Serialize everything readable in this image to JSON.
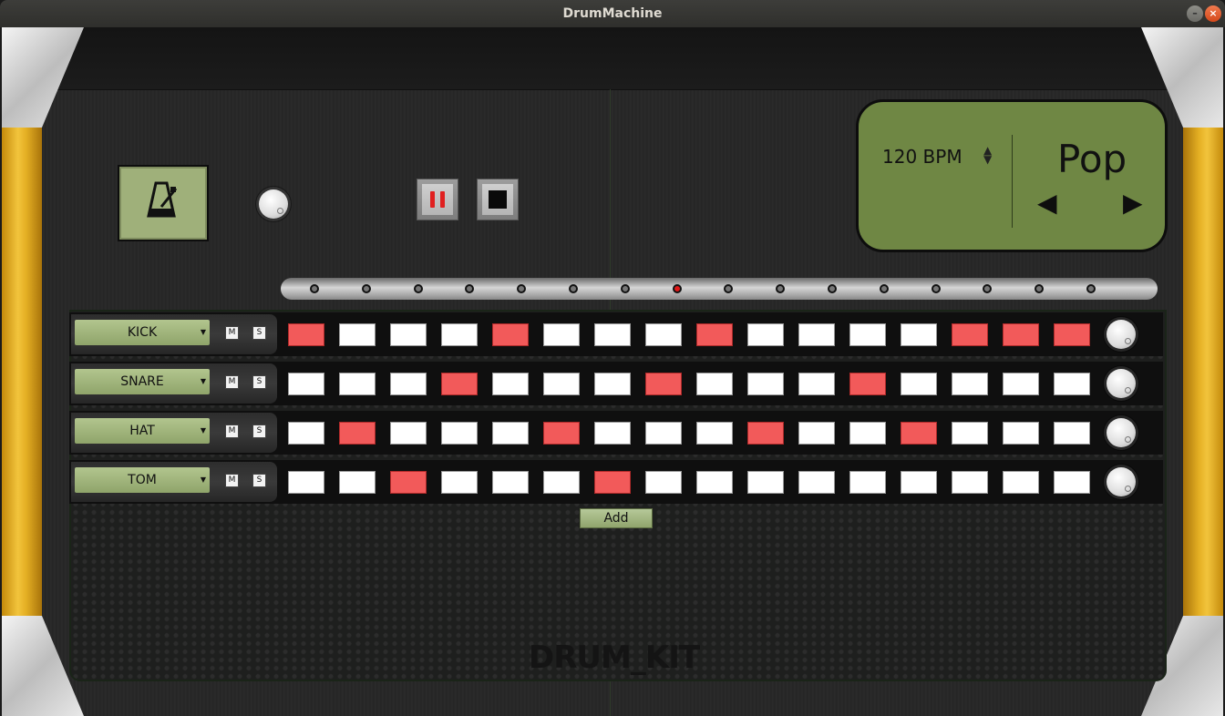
{
  "window": {
    "title": "DrumMachine",
    "minimize_icon": "minimize-icon",
    "close_icon": "close-icon"
  },
  "transport": {
    "metronome_icon": "metronome-icon",
    "metronome_volume_icon": "volume-knob",
    "pause_icon": "pause-icon",
    "stop_icon": "stop-icon"
  },
  "display": {
    "bpm_label": "120 BPM",
    "bpm_spinner": "▲▼",
    "kit_name": "Pop",
    "prev_icon": "◀",
    "next_icon": "▶"
  },
  "step_indicator": {
    "count": 16,
    "active": 8
  },
  "tracks": [
    {
      "instrument": "KICK",
      "mute": "M",
      "solo": "S",
      "steps": [
        1,
        0,
        0,
        0,
        1,
        0,
        0,
        0,
        1,
        0,
        0,
        0,
        0,
        1,
        1,
        1
      ]
    },
    {
      "instrument": "SNARE",
      "mute": "M",
      "solo": "S",
      "steps": [
        0,
        0,
        0,
        1,
        0,
        0,
        0,
        1,
        0,
        0,
        0,
        1,
        0,
        0,
        0,
        0
      ]
    },
    {
      "instrument": "HAT",
      "mute": "M",
      "solo": "S",
      "steps": [
        0,
        1,
        0,
        0,
        0,
        1,
        0,
        0,
        0,
        1,
        0,
        0,
        1,
        0,
        0,
        0
      ]
    },
    {
      "instrument": "TOM",
      "mute": "M",
      "solo": "S",
      "steps": [
        0,
        0,
        1,
        0,
        0,
        0,
        1,
        0,
        0,
        0,
        0,
        0,
        0,
        0,
        0,
        0
      ]
    }
  ],
  "add_button_label": "Add",
  "brand_text": "DRUM_KIT",
  "colors": {
    "step_on": "#f25a5a",
    "step_off": "#ffffff",
    "lcd": "#6f8744",
    "selector": "#a5b982"
  }
}
